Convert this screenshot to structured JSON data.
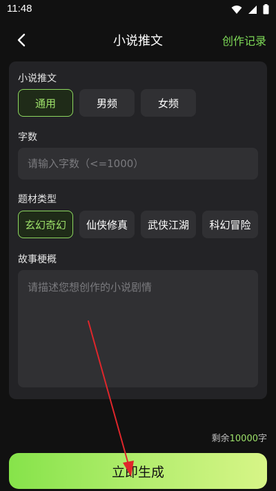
{
  "status_bar": {
    "time": "11:48"
  },
  "nav": {
    "title": "小说推文",
    "record_label": "创作记录"
  },
  "section_type": {
    "label": "小说推文",
    "options": [
      "通用",
      "男频",
      "女频"
    ],
    "selected": "通用"
  },
  "section_words": {
    "label": "字数",
    "placeholder": "请输入字数（<=1000）"
  },
  "section_genre": {
    "label": "题材类型",
    "options": [
      "玄幻奇幻",
      "仙侠修真",
      "武侠江湖",
      "科幻冒险"
    ],
    "selected": "玄幻奇幻"
  },
  "section_plot": {
    "label": "故事梗概",
    "placeholder": "请描述您想创作的小说剧情"
  },
  "remaining": {
    "prefix": "剩余",
    "count": "10000",
    "suffix": "字"
  },
  "generate": {
    "label": "立即生成"
  },
  "colors": {
    "accent": "#8ed860",
    "background": "#111111",
    "card": "#232326",
    "annotation_arrow": "#e0262b"
  }
}
